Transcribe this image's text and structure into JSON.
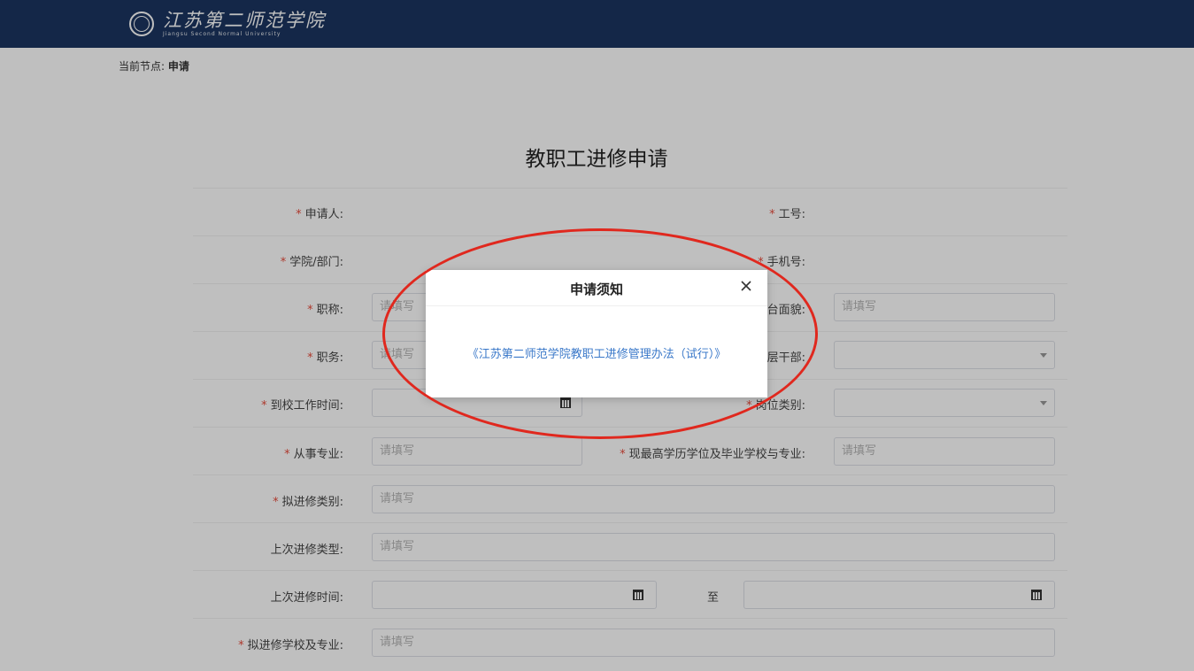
{
  "header": {
    "school_name_cn": "江苏第二师范学院",
    "school_name_en": "Jiangsu Second Normal University"
  },
  "breadcrumb": {
    "prefix": "当前节点:",
    "node": "申请"
  },
  "form": {
    "title": "教职工进修申请",
    "placeholder": "请填写",
    "required_mark": "*",
    "labels": {
      "applicant": "申请人:",
      "staff_no": "工号:",
      "department": "学院/部门:",
      "phone": "手机号:",
      "title": "职称:",
      "political_status": "政治面貌:",
      "position": "职务:",
      "cadre": "中层干部:",
      "start_date": "到校工作时间:",
      "post_type": "岗位类别:",
      "major": "从事专业:",
      "highest_degree": "现最高学历学位及毕业学校与专业:",
      "study_type": "拟进修类别:",
      "last_study_type": "上次进修类型:",
      "last_study_time": "上次进修时间:",
      "target_school": "拟进修学校及专业:"
    },
    "visible_labels": {
      "political_status": "台面貌:",
      "cadre": "层干部:",
      "post_type": "岗位类别:"
    },
    "range_separator": "至"
  },
  "modal": {
    "title": "申请须知",
    "link_text": "《江苏第二师范学院教职工进修管理办法（试行）》"
  },
  "icons": [
    "school-seal-icon",
    "close-icon",
    "calendar-icon",
    "chevron-down-icon"
  ],
  "colors": {
    "header_bg": "#1b3560",
    "required": "#e74c3c",
    "link": "#3a78c9",
    "annotation": "#e0281e"
  }
}
